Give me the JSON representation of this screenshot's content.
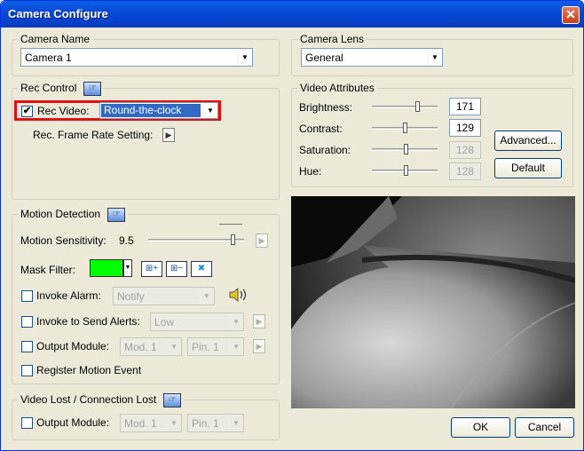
{
  "window": {
    "title": "Camera Configure",
    "close_glyph": "✕"
  },
  "camera_name": {
    "legend": "Camera Name",
    "value": "Camera 1"
  },
  "camera_lens": {
    "legend": "Camera Lens",
    "value": "General"
  },
  "rec_control": {
    "legend": "Rec Control",
    "rec_video_label": "Rec Video:",
    "rec_video_checked": true,
    "rec_video_value": "Round-the-clock",
    "frame_rate_label": "Rec. Frame Rate Setting:",
    "highlight_color": "#e01010"
  },
  "video_attributes": {
    "legend": "Video Attributes",
    "brightness_label": "Brightness:",
    "brightness": "171",
    "contrast_label": "Contrast:",
    "contrast": "129",
    "saturation_label": "Saturation:",
    "saturation": "128",
    "hue_label": "Hue:",
    "hue": "128",
    "advanced_button": "Advanced...",
    "default_button": "Default"
  },
  "motion_detection": {
    "legend": "Motion Detection",
    "sensitivity_label": "Motion Sensitivity:",
    "sensitivity_value": "9.5",
    "mask_filter_label": "Mask Filter:",
    "mask_color": "#00ff00",
    "invoke_alarm_label": "Invoke Alarm:",
    "invoke_alarm_value": "Notify",
    "invoke_alerts_label": "Invoke to Send Alerts:",
    "invoke_alerts_value": "Low",
    "output_module_label": "Output Module:",
    "output_module_value": "Mod. 1",
    "output_pin_value": "Pin. 1",
    "register_event_label": "Register Motion Event"
  },
  "video_lost": {
    "legend": "Video Lost / Connection Lost",
    "output_module_label": "Output Module:",
    "output_module_value": "Mod. 1",
    "output_pin_value": "Pin. 1"
  },
  "buttons": {
    "ok": "OK",
    "cancel": "Cancel"
  },
  "check_glyph": "✔"
}
